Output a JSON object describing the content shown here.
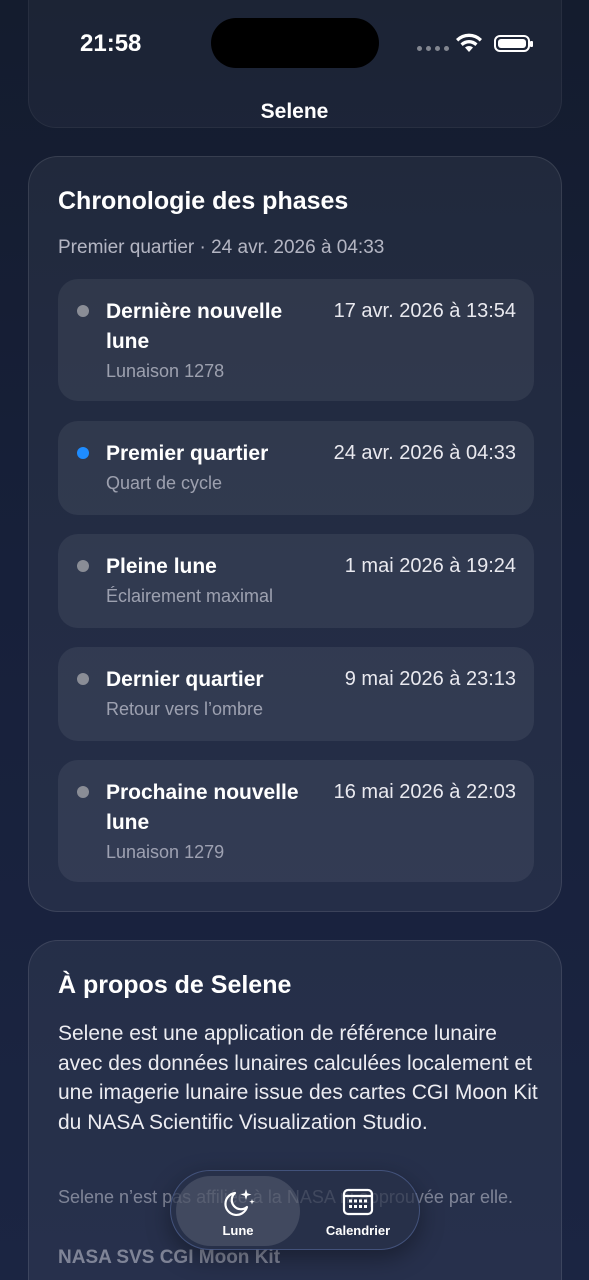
{
  "status_bar": {
    "time": "21:58"
  },
  "nav": {
    "title": "Selene"
  },
  "timeline": {
    "title": "Chronologie des phases",
    "subtitle": "Premier quartier · 24 avr. 2026 à 04:33",
    "phases": [
      {
        "name": "Dernière nouvelle lune",
        "sub": "Lunaison 1278",
        "date": "17 avr. 2026 à 13:54",
        "active": false
      },
      {
        "name": "Premier quartier",
        "sub": "Quart de cycle",
        "date": "24 avr. 2026 à 04:33",
        "active": true
      },
      {
        "name": "Pleine lune",
        "sub": "Éclairement maximal",
        "date": "1 mai 2026 à 19:24",
        "active": false
      },
      {
        "name": "Dernier quartier",
        "sub": "Retour vers l’ombre",
        "date": "9 mai 2026 à 23:13",
        "active": false
      },
      {
        "name": "Prochaine nouvelle lune",
        "sub": "Lunaison 1279",
        "date": "16 mai 2026 à 22:03",
        "active": false
      }
    ]
  },
  "about": {
    "title": "À propos de Selene",
    "text": "Selene est une application de référence lunaire avec des données lunaires calculées localement et une imagerie lunaire issue des cartes CGI Moon Kit du NASA Scientific Visualization Studio.",
    "text2": "Selene n’est pas affiliée à la NASA ni approuvée par elle.",
    "text3": "NASA SVS CGI Moon Kit"
  },
  "tabbar": {
    "items": [
      {
        "label": "Lune",
        "icon": "moon-stars-icon",
        "selected": true
      },
      {
        "label": "Calendrier",
        "icon": "calendar-icon",
        "selected": false
      }
    ]
  },
  "colors": {
    "accent": "#1e8cff",
    "inactive_dot": "#8a8d96"
  }
}
